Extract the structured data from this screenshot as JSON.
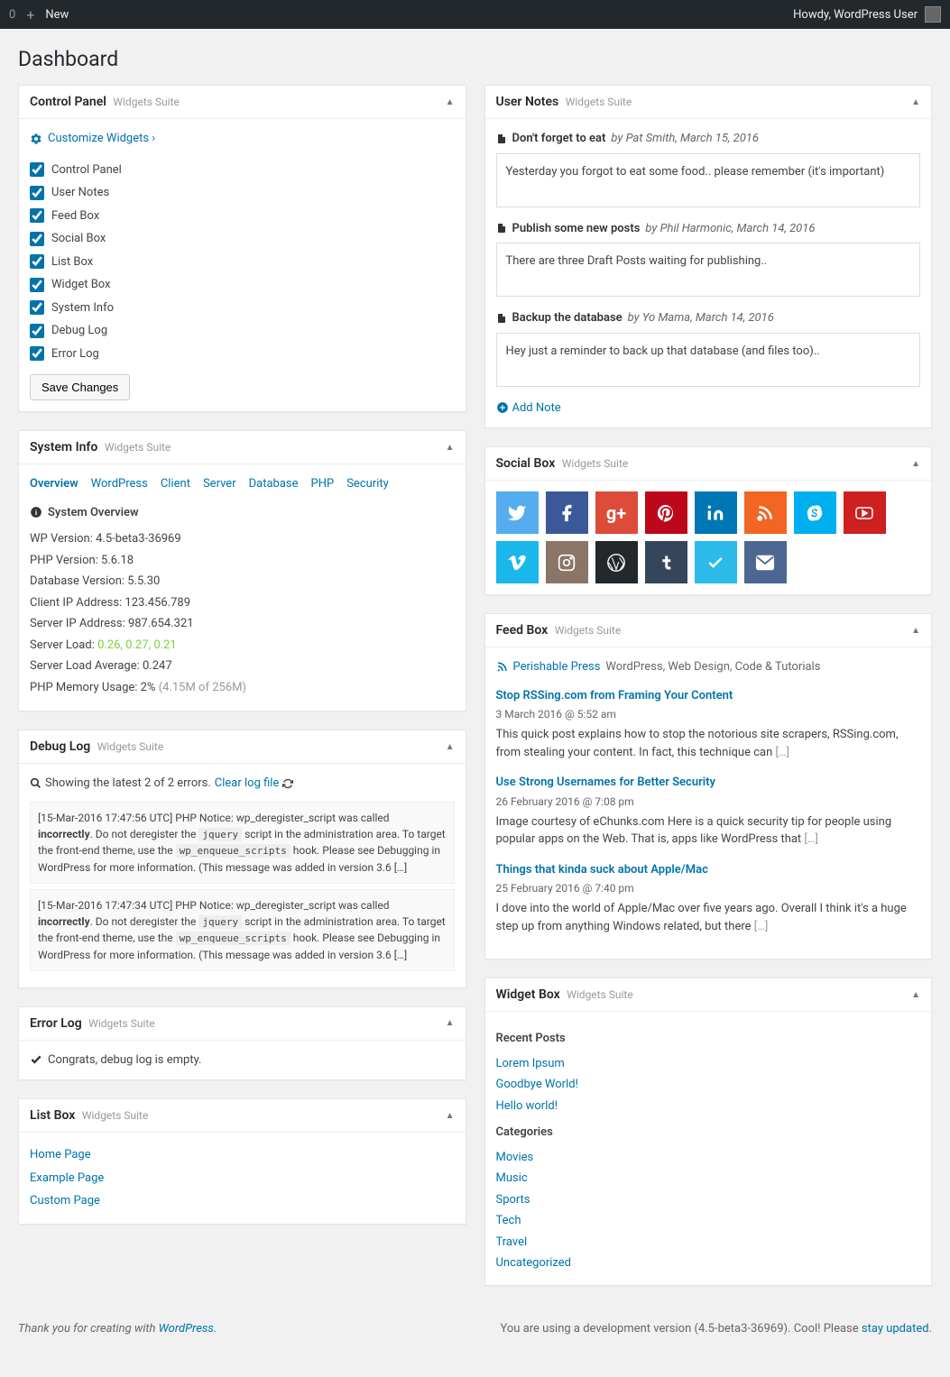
{
  "adminBar": {
    "count": "0",
    "newLabel": "New",
    "greeting": "Howdy, WordPress User"
  },
  "pageTitle": "Dashboard",
  "suiteLabel": "Widgets Suite",
  "controlPanel": {
    "title": "Control Panel",
    "customizeLink": "Customize Widgets ›",
    "items": [
      "Control Panel",
      "User Notes",
      "Feed Box",
      "Social Box",
      "List Box",
      "Widget Box",
      "System Info",
      "Debug Log",
      "Error Log"
    ],
    "saveButton": "Save Changes"
  },
  "systemInfo": {
    "title": "System Info",
    "tabs": [
      "Overview",
      "WordPress",
      "Client",
      "Server",
      "Database",
      "PHP",
      "Security"
    ],
    "heading": "System Overview",
    "rows": {
      "wp": "WP Version: 4.5-beta3-36969",
      "php": "PHP Version: 5.6.18",
      "db": "Database Version: 5.5.30",
      "clientIp": "Client IP Address: 123.456.789",
      "serverIp": "Server IP Address: 987.654.321",
      "loadLabel": "Server Load: ",
      "loadValue": "0.26, 0.27, 0.21",
      "loadAvg": "Server Load Average: 0.247",
      "memLabel": "PHP Memory Usage: 2% ",
      "memValue": "(4.15M of 256M)"
    }
  },
  "debugLog": {
    "title": "Debug Log",
    "showing": "Showing the latest 2 of 2 errors.",
    "clearLink": "Clear log file",
    "entries": [
      {
        "p1": "[15-Mar-2016 17:47:56 UTC] PHP Notice: wp_deregister_script was called ",
        "b1": "incorrectly",
        "p2": ". Do not deregister the ",
        "c1": "jquery",
        "p3": " script in the administration area. To target the front-end theme, use the ",
        "c2": "wp_enqueue_scripts",
        "p4": " hook. Please see Debugging in WordPress for more information. (This message was added in version 3.6 […]"
      },
      {
        "p1": "[15-Mar-2016 17:47:34 UTC] PHP Notice: wp_deregister_script was called ",
        "b1": "incorrectly",
        "p2": ". Do not deregister the ",
        "c1": "jquery",
        "p3": " script in the administration area. To target the front-end theme, use the ",
        "c2": "wp_enqueue_scripts",
        "p4": " hook. Please see Debugging in WordPress for more information. (This message was added in version 3.6 […]"
      }
    ]
  },
  "errorLog": {
    "title": "Error Log",
    "message": "Congrats, debug log is empty."
  },
  "listBox": {
    "title": "List Box",
    "links": [
      "Home Page",
      "Example Page",
      "Custom Page"
    ]
  },
  "userNotes": {
    "title": "User Notes",
    "notes": [
      {
        "title": "Don't forget to eat",
        "meta": "by Pat Smith, March 15, 2016",
        "body": "Yesterday you forgot to eat some food.. please remember (it's important)"
      },
      {
        "title": "Publish some new posts",
        "meta": "by Phil Harmonic, March 14, 2016",
        "body": "There are three Draft Posts waiting for publishing.."
      },
      {
        "title": "Backup the database",
        "meta": "by Yo Mama, March 14, 2016",
        "body": "Hey just a reminder to back up that database (and files too).."
      }
    ],
    "addLabel": "Add Note"
  },
  "socialBox": {
    "title": "Social Box",
    "icons": [
      {
        "name": "twitter",
        "bg": "#55acee"
      },
      {
        "name": "facebook",
        "bg": "#3b5998"
      },
      {
        "name": "google-plus",
        "bg": "#dd4b39"
      },
      {
        "name": "pinterest",
        "bg": "#bd081c"
      },
      {
        "name": "linkedin",
        "bg": "#0077b5"
      },
      {
        "name": "rss",
        "bg": "#f26522"
      },
      {
        "name": "skype",
        "bg": "#00aff0"
      },
      {
        "name": "youtube",
        "bg": "#cd201f"
      },
      {
        "name": "vimeo",
        "bg": "#1ab7ea"
      },
      {
        "name": "instagram",
        "bg": "#8a7566"
      },
      {
        "name": "wordpress",
        "bg": "#23282d"
      },
      {
        "name": "tumblr",
        "bg": "#35465c"
      },
      {
        "name": "foursquare",
        "bg": "#2cbbe9"
      },
      {
        "name": "email",
        "bg": "#4d6692"
      }
    ]
  },
  "feedBox": {
    "title": "Feed Box",
    "sourceName": "Perishable Press",
    "sourceDesc": "WordPress, Web Design, Code & Tutorials",
    "items": [
      {
        "title": "Stop RSSing.com from Framing Your Content",
        "date": "3 March 2016 @ 5:52 am",
        "excerpt": "This quick post explains how to stop the notorious site scrapers, RSSing.com, from stealing your content. In fact, this technique can "
      },
      {
        "title": "Use Strong Usernames for Better Security",
        "date": "26 February 2016 @ 7:08 pm",
        "excerpt": "Image courtesy of eChunks.com Here is a quick security tip for people using popular apps on the Web. That is, apps like WordPress that "
      },
      {
        "title": "Things that kinda suck about Apple/Mac",
        "date": "25 February 2016 @ 7:40 pm",
        "excerpt": "I dove into the world of Apple/Mac over five years ago. Overall I think it's a huge step up from anything Windows related, but there "
      }
    ],
    "more": "[…]"
  },
  "widgetBox": {
    "title": "Widget Box",
    "recentHeading": "Recent Posts",
    "recent": [
      "Lorem Ipsum",
      "Goodbye World!",
      "Hello world!"
    ],
    "catHeading": "Categories",
    "categories": [
      "Movies",
      "Music",
      "Sports",
      "Tech",
      "Travel",
      "Uncategorized"
    ]
  },
  "footer": {
    "thankLabel": "Thank you for creating with ",
    "wpLink": "WordPress.",
    "devLabel1": "You are using a development version (4.5-beta3-36969). Cool! Please ",
    "stayLink": "stay updated",
    "dot": "."
  }
}
